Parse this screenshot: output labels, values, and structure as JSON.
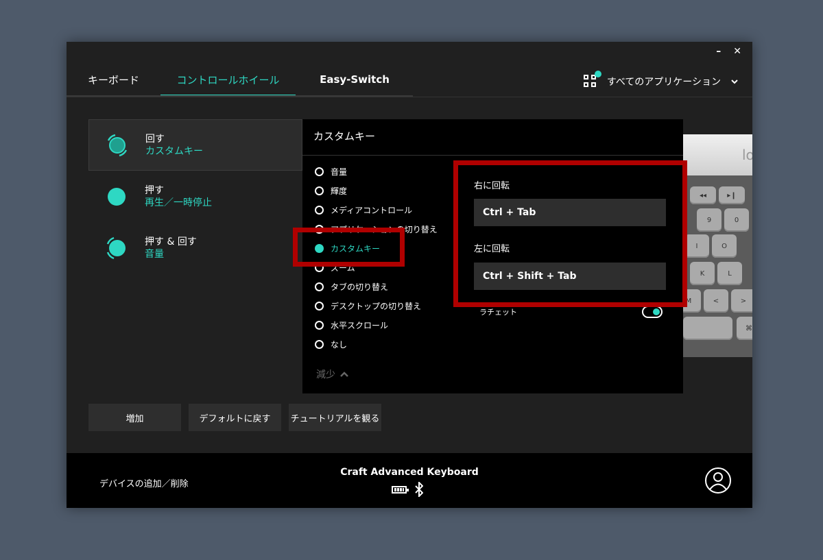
{
  "window": {
    "controls": {
      "minimize": "–",
      "close": "✕"
    }
  },
  "tabs": [
    {
      "label": "キーボード"
    },
    {
      "label": "コントロールホイール"
    },
    {
      "label": "Easy-Switch"
    }
  ],
  "app_selector": {
    "label": "すべてのアプリケーション",
    "icon": "app-grid-icon"
  },
  "left_items": [
    {
      "title": "回す",
      "subtitle": "カスタムキー"
    },
    {
      "title": "押す",
      "subtitle": "再生／一時停止"
    },
    {
      "title": "押す & 回す",
      "subtitle": "音量"
    }
  ],
  "custom_panel": {
    "title": "カスタムキー",
    "options": [
      "音量",
      "輝度",
      "メディアコントロール",
      "アプリケーションの切り替え",
      "カスタムキー",
      "ズーム",
      "タブの切り替え",
      "デスクトップの切り替え",
      "水平スクロール",
      "なし"
    ],
    "selected": "カスタムキー",
    "less_label": "減少",
    "right_rotate_label": "右に回転",
    "right_rotate_value": "Ctrl + Tab",
    "left_rotate_label": "左に回転",
    "left_rotate_value": "Ctrl + Shift + Tab",
    "ratchet_label": "ラチェット",
    "ratchet_on": true
  },
  "keyboard_keys": [
    "9",
    "0",
    "I",
    "O",
    "K",
    "L",
    "M",
    "<",
    ">",
    "⌘"
  ],
  "buttons": {
    "add": "増加",
    "reset": "デフォルトに戻す",
    "tutorial": "チュートリアルを観る"
  },
  "footer": {
    "add_remove": "デバイスの追加／削除",
    "device_name": "Craft Advanced Keyboard"
  },
  "colors": {
    "accent": "#2ed8c3",
    "highlight": "#b00000"
  }
}
